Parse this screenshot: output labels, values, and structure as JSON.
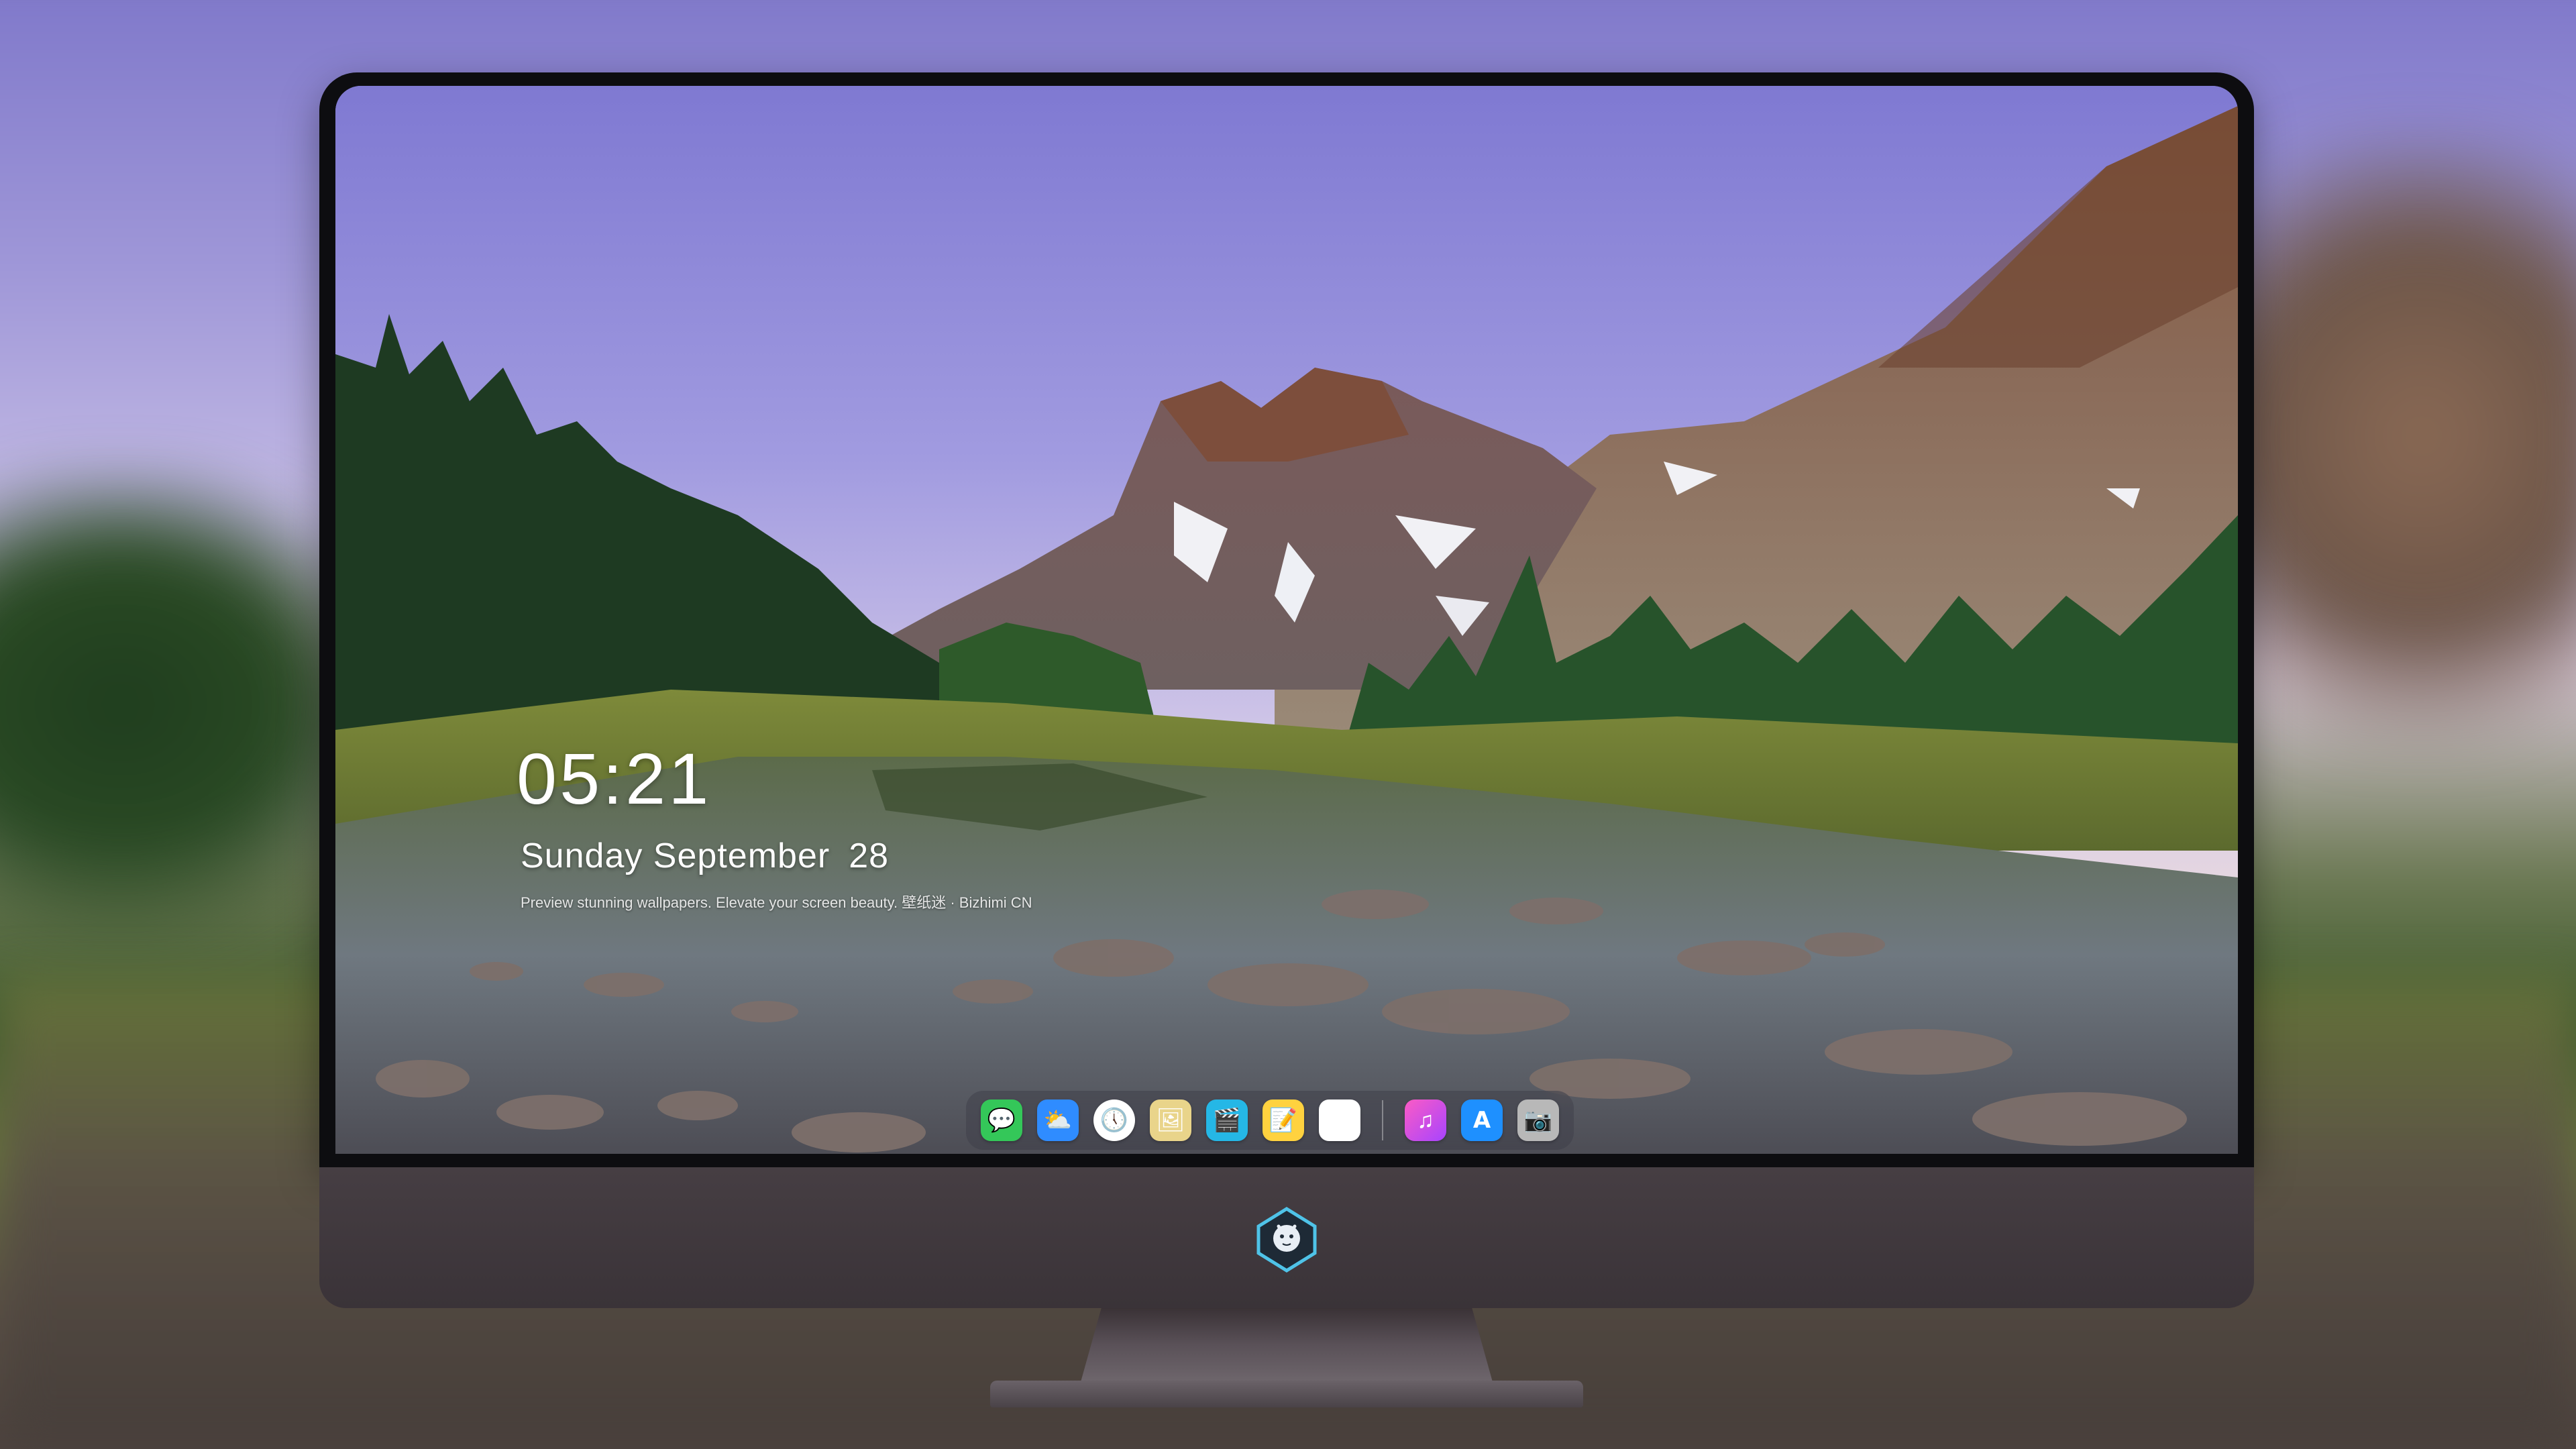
{
  "lockscreen": {
    "time": "05:21",
    "weekday_month": "Sunday September",
    "day": "28",
    "caption": "Preview stunning wallpapers. Elevate your screen beauty. 壁纸迷 · Bizhimi CN"
  },
  "dock": {
    "apps": [
      {
        "icon": "messages-icon",
        "color": "#34c759",
        "glyph": "💬"
      },
      {
        "icon": "weather-icon",
        "color": "#2f8cff",
        "glyph": "⛅"
      },
      {
        "icon": "clock-icon",
        "color": "#ffffff",
        "glyph": "🕔"
      },
      {
        "icon": "preview-icon",
        "color": "#e9d48a",
        "glyph": "🖼"
      },
      {
        "icon": "video-icon",
        "color": "#25b7e6",
        "glyph": "🎬"
      },
      {
        "icon": "notes-icon",
        "color": "#ffd23f",
        "glyph": "📝"
      },
      {
        "icon": "photos-icon",
        "color": "#ffffff",
        "glyph": "🏞"
      }
    ],
    "apps_right": [
      {
        "icon": "music-icon",
        "color": "#fb5bc5",
        "glyph": "♫"
      },
      {
        "icon": "app-store-icon",
        "color": "#1e90ff",
        "glyph": "A"
      },
      {
        "icon": "camera-icon",
        "color": "#b8b8b8",
        "glyph": "📷"
      }
    ]
  }
}
